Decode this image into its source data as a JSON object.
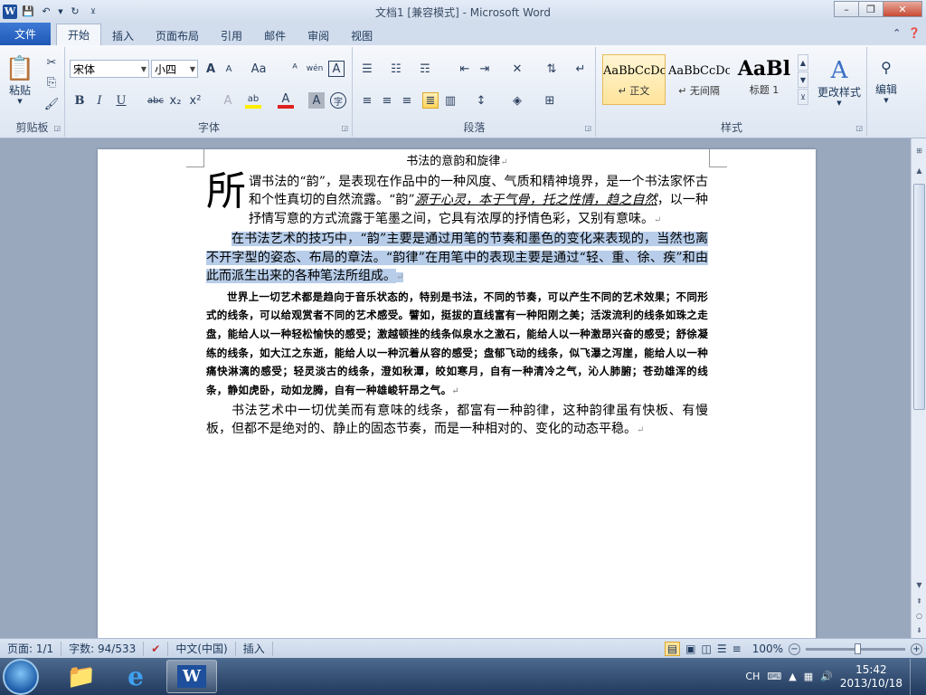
{
  "window": {
    "title": "文档1 [兼容模式] - Microsoft Word",
    "min": "–",
    "max": "❐",
    "close": "✕"
  },
  "qat": {
    "logo": "W"
  },
  "tabs": [
    {
      "label": "文件"
    },
    {
      "label": "开始"
    },
    {
      "label": "插入"
    },
    {
      "label": "页面布局"
    },
    {
      "label": "引用"
    },
    {
      "label": "邮件"
    },
    {
      "label": "审阅"
    },
    {
      "label": "视图"
    }
  ],
  "ribbon": {
    "clipboard": {
      "paste": "粘贴",
      "label": "剪贴板"
    },
    "font": {
      "name": "宋体",
      "size": "小四",
      "label": "字体",
      "bold": "B",
      "italic": "I",
      "underline": "U",
      "strike": "abc",
      "sub": "x₂",
      "sup": "x²",
      "grow": "A",
      "shrink": "A",
      "case": "Aa",
      "clear": "ᴬ",
      "phon": "wén",
      "border": "A",
      "fcolor": "A",
      "hl": "ab",
      "shade": "A",
      "circle": "字"
    },
    "paragraph": {
      "label": "段落"
    },
    "styles": {
      "label": "样式",
      "items": [
        {
          "preview": "AaBbCcDc",
          "name": "↵ 正文"
        },
        {
          "preview": "AaBbCcDc",
          "name": "↵ 无间隔"
        },
        {
          "preview": "AaBl",
          "name": "标题 1"
        }
      ],
      "change": "更改样式"
    },
    "editing": {
      "label": "编辑"
    }
  },
  "document": {
    "title": "书法的意韵和旋律",
    "dropcap": "所",
    "p1a": "谓书法的“韵”，是表现在作品中的一种风度、气质和精神境界，是一个书法家怀古和个性真切的自然流露。“韵”",
    "p1b": "源于心灵，本于气骨，托之性情，趋之自然",
    "p1c": "，以一种抒情写意的方式流露于笔墨之间，它具有浓厚的抒情色彩，又别有意味。",
    "p2": "在书法艺术的技巧中，“韵”主要是通过用笔的节奏和墨色的变化来表现的，当然也离不开字型的姿态、布局的章法。“韵律”在用笔中的表现主要是通过“轻、重、徐、疾”和由此而派生出来的各种笔法所组成。",
    "p3": "世界上一切艺术都是趋向于音乐状态的，特别是书法，不同的节奏，可以产生不同的艺术效果；不同形式的线条，可以给观赏者不同的艺术感受。譬如，挺拔的直线富有一种阳刚之美；活泼流利的线条如珠之走盘，能给人以一种轻松愉快的感受；激越顿挫的线条似泉水之激石，能给人以一种激昂兴奋的感受；舒徐凝练的线条，如大江之东逝，能给人以一种沉着从容的感受；盘郁飞动的线条，似飞瀑之泻崖，能给人以一种痛快淋漓的感受；轻灵淡古的线条，澄如秋潭，皎如寒月，自有一种清冷之气，沁人肺腑；苍劲雄浑的线条，静如虎卧，动如龙腾，自有一种雄峻轩昂之气。",
    "p4": "书法艺术中一切优美而有意味的线条，都富有一种韵律，这种韵律虽有快板、有慢板，但都不是绝对的、静止的固态节奏，而是一种相对的、变化的动态平稳。",
    "pmark": "↵"
  },
  "status": {
    "page": "页面: 1/1",
    "words": "字数: 94/533",
    "lang": "中文(中国)",
    "mode": "插入",
    "zoom": "100%",
    "minus": "−",
    "plus": "+"
  },
  "taskbar": {
    "ime": "CH",
    "time": "15:42",
    "date": "2013/10/18"
  }
}
